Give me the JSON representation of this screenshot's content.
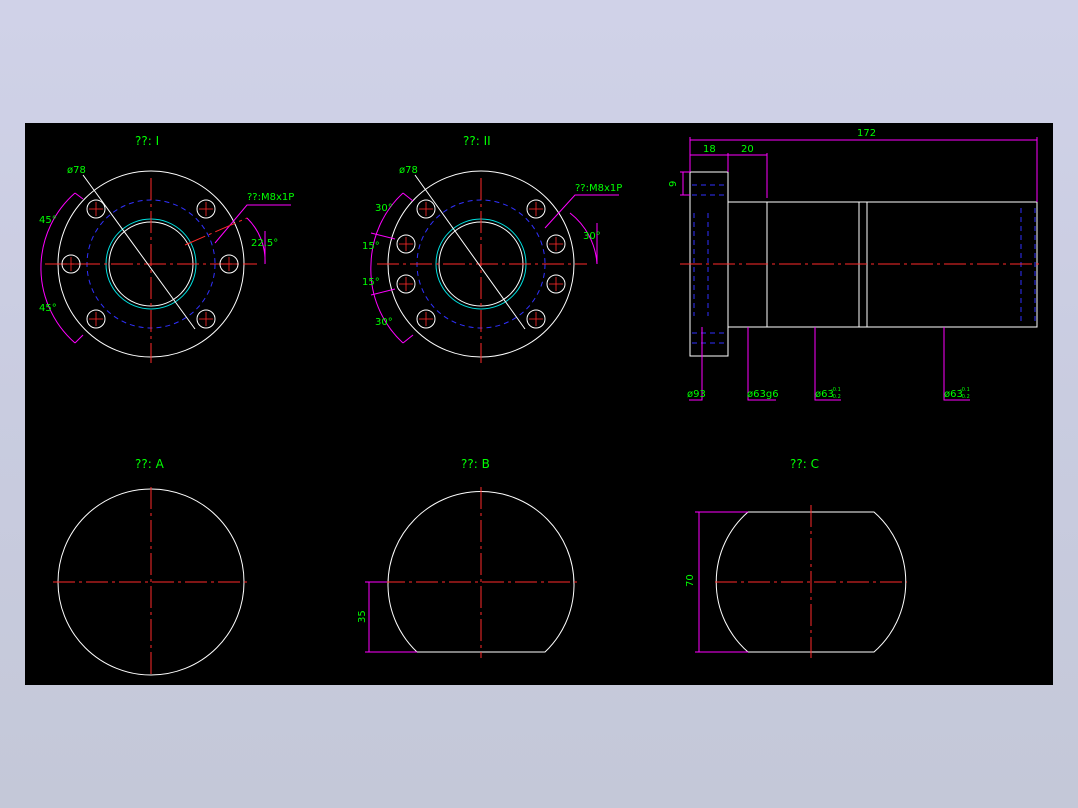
{
  "colors": {
    "background": "#000000",
    "geometry": "#ffffff",
    "centerline": "#ff2a2a",
    "dimension": "#ff00ff",
    "text": "#00ff00",
    "hidden": "#3030ff",
    "thread": "#00e0e0"
  },
  "views": {
    "type1_title": "??: I",
    "type2_title": "??: II",
    "a_title": "??: A",
    "b_title": "??: B",
    "c_title": "??: C"
  },
  "type1": {
    "dia": "ø78",
    "thread": "??:M8x1P",
    "angle_top": "45°",
    "angle_bottom": "45°",
    "angle_right": "22.5°"
  },
  "type2": {
    "dia": "ø78",
    "thread": "??:M8x1P",
    "angle_a": "30°",
    "angle_b": "15°",
    "angle_c": "15°",
    "angle_d": "30°",
    "angle_right": "30°"
  },
  "side": {
    "len_total": "172",
    "len_flange": "18",
    "len_seg": "20",
    "thick": "9",
    "d1": "ø93",
    "d2": "ø63g6",
    "d3": "ø63",
    "d4": "ø63",
    "tol_up": "-0.1",
    "tol_low": "-0.2"
  },
  "viewB": {
    "dim": "35"
  },
  "viewC": {
    "dim": "70"
  }
}
